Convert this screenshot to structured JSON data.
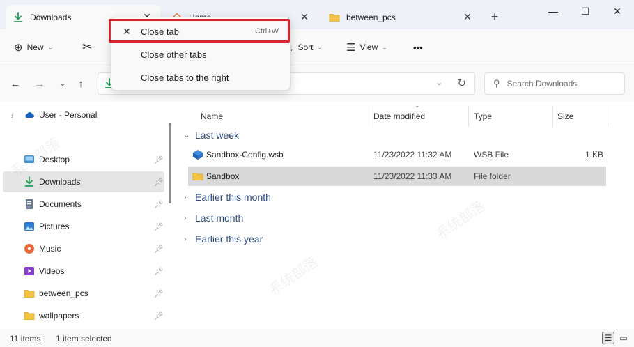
{
  "tabs": [
    {
      "label": "Downloads",
      "icon": "download-icon",
      "close": "✕"
    },
    {
      "label": "Home",
      "icon": "home-icon",
      "close": "✕"
    },
    {
      "label": "between_pcs",
      "icon": "folder-icon",
      "close": "✕"
    }
  ],
  "new_tab": "+",
  "window_controls": {
    "minimize": "—",
    "maximize": "☐",
    "close": "✕"
  },
  "toolbar": {
    "new_label": "New",
    "sort_label": "Sort",
    "view_label": "View",
    "more": "•••"
  },
  "search": {
    "placeholder": "Search Downloads"
  },
  "sidebar": {
    "user_label": "User - Personal",
    "items": [
      {
        "label": "Desktop",
        "icon": "desktop-icon"
      },
      {
        "label": "Downloads",
        "icon": "download-icon",
        "selected": true
      },
      {
        "label": "Documents",
        "icon": "documents-icon"
      },
      {
        "label": "Pictures",
        "icon": "pictures-icon"
      },
      {
        "label": "Music",
        "icon": "music-icon"
      },
      {
        "label": "Videos",
        "icon": "videos-icon"
      },
      {
        "label": "between_pcs",
        "icon": "folder-icon"
      },
      {
        "label": "wallpapers",
        "icon": "folder-icon"
      }
    ]
  },
  "columns": {
    "name": "Name",
    "date": "Date modified",
    "type": "Type",
    "size": "Size"
  },
  "groups": {
    "last_week": "Last week",
    "earlier_month": "Earlier this month",
    "last_month": "Last month",
    "earlier_year": "Earlier this year"
  },
  "files": [
    {
      "name": "Sandbox-Config.wsb",
      "date": "11/23/2022 11:32 AM",
      "type": "WSB File",
      "size": "1 KB"
    },
    {
      "name": "Sandbox",
      "date": "11/23/2022 11:33 AM",
      "type": "File folder",
      "size": ""
    }
  ],
  "status": {
    "items": "11 items",
    "selected": "1 item selected"
  },
  "context_menu": {
    "items": [
      {
        "label": "Close tab",
        "shortcut": "Ctrl+W",
        "icon": "close-icon"
      },
      {
        "label": "Close other tabs",
        "shortcut": ""
      },
      {
        "label": "Close tabs to the right",
        "shortcut": ""
      }
    ]
  },
  "colors": {
    "accent": "#1f9d55",
    "folder": "#f4c542",
    "highlight": "#d7262e",
    "group_text": "#2b4a7e"
  }
}
